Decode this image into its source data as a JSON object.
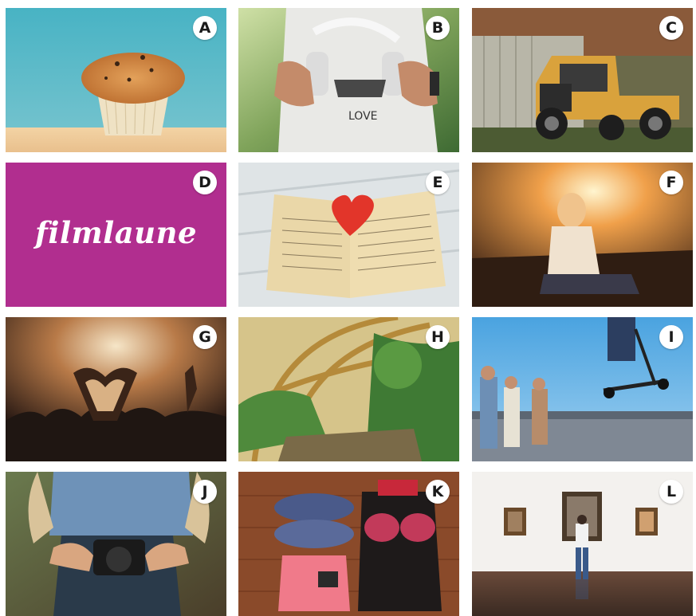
{
  "tiles": [
    {
      "id": "A",
      "subject": "muffin"
    },
    {
      "id": "B",
      "subject": "headphones"
    },
    {
      "id": "C",
      "subject": "vintage-truck"
    },
    {
      "id": "D",
      "subject": "filmlaune-logo",
      "text": "filmlaune",
      "color": "#b12e8f"
    },
    {
      "id": "E",
      "subject": "book-heart"
    },
    {
      "id": "F",
      "subject": "sunset-woman"
    },
    {
      "id": "G",
      "subject": "concert-crowd"
    },
    {
      "id": "H",
      "subject": "greenhouse"
    },
    {
      "id": "I",
      "subject": "scooter-jump"
    },
    {
      "id": "J",
      "subject": "camera-hands"
    },
    {
      "id": "K",
      "subject": "clothes-flatlay"
    },
    {
      "id": "L",
      "subject": "museum-gallery"
    }
  ]
}
